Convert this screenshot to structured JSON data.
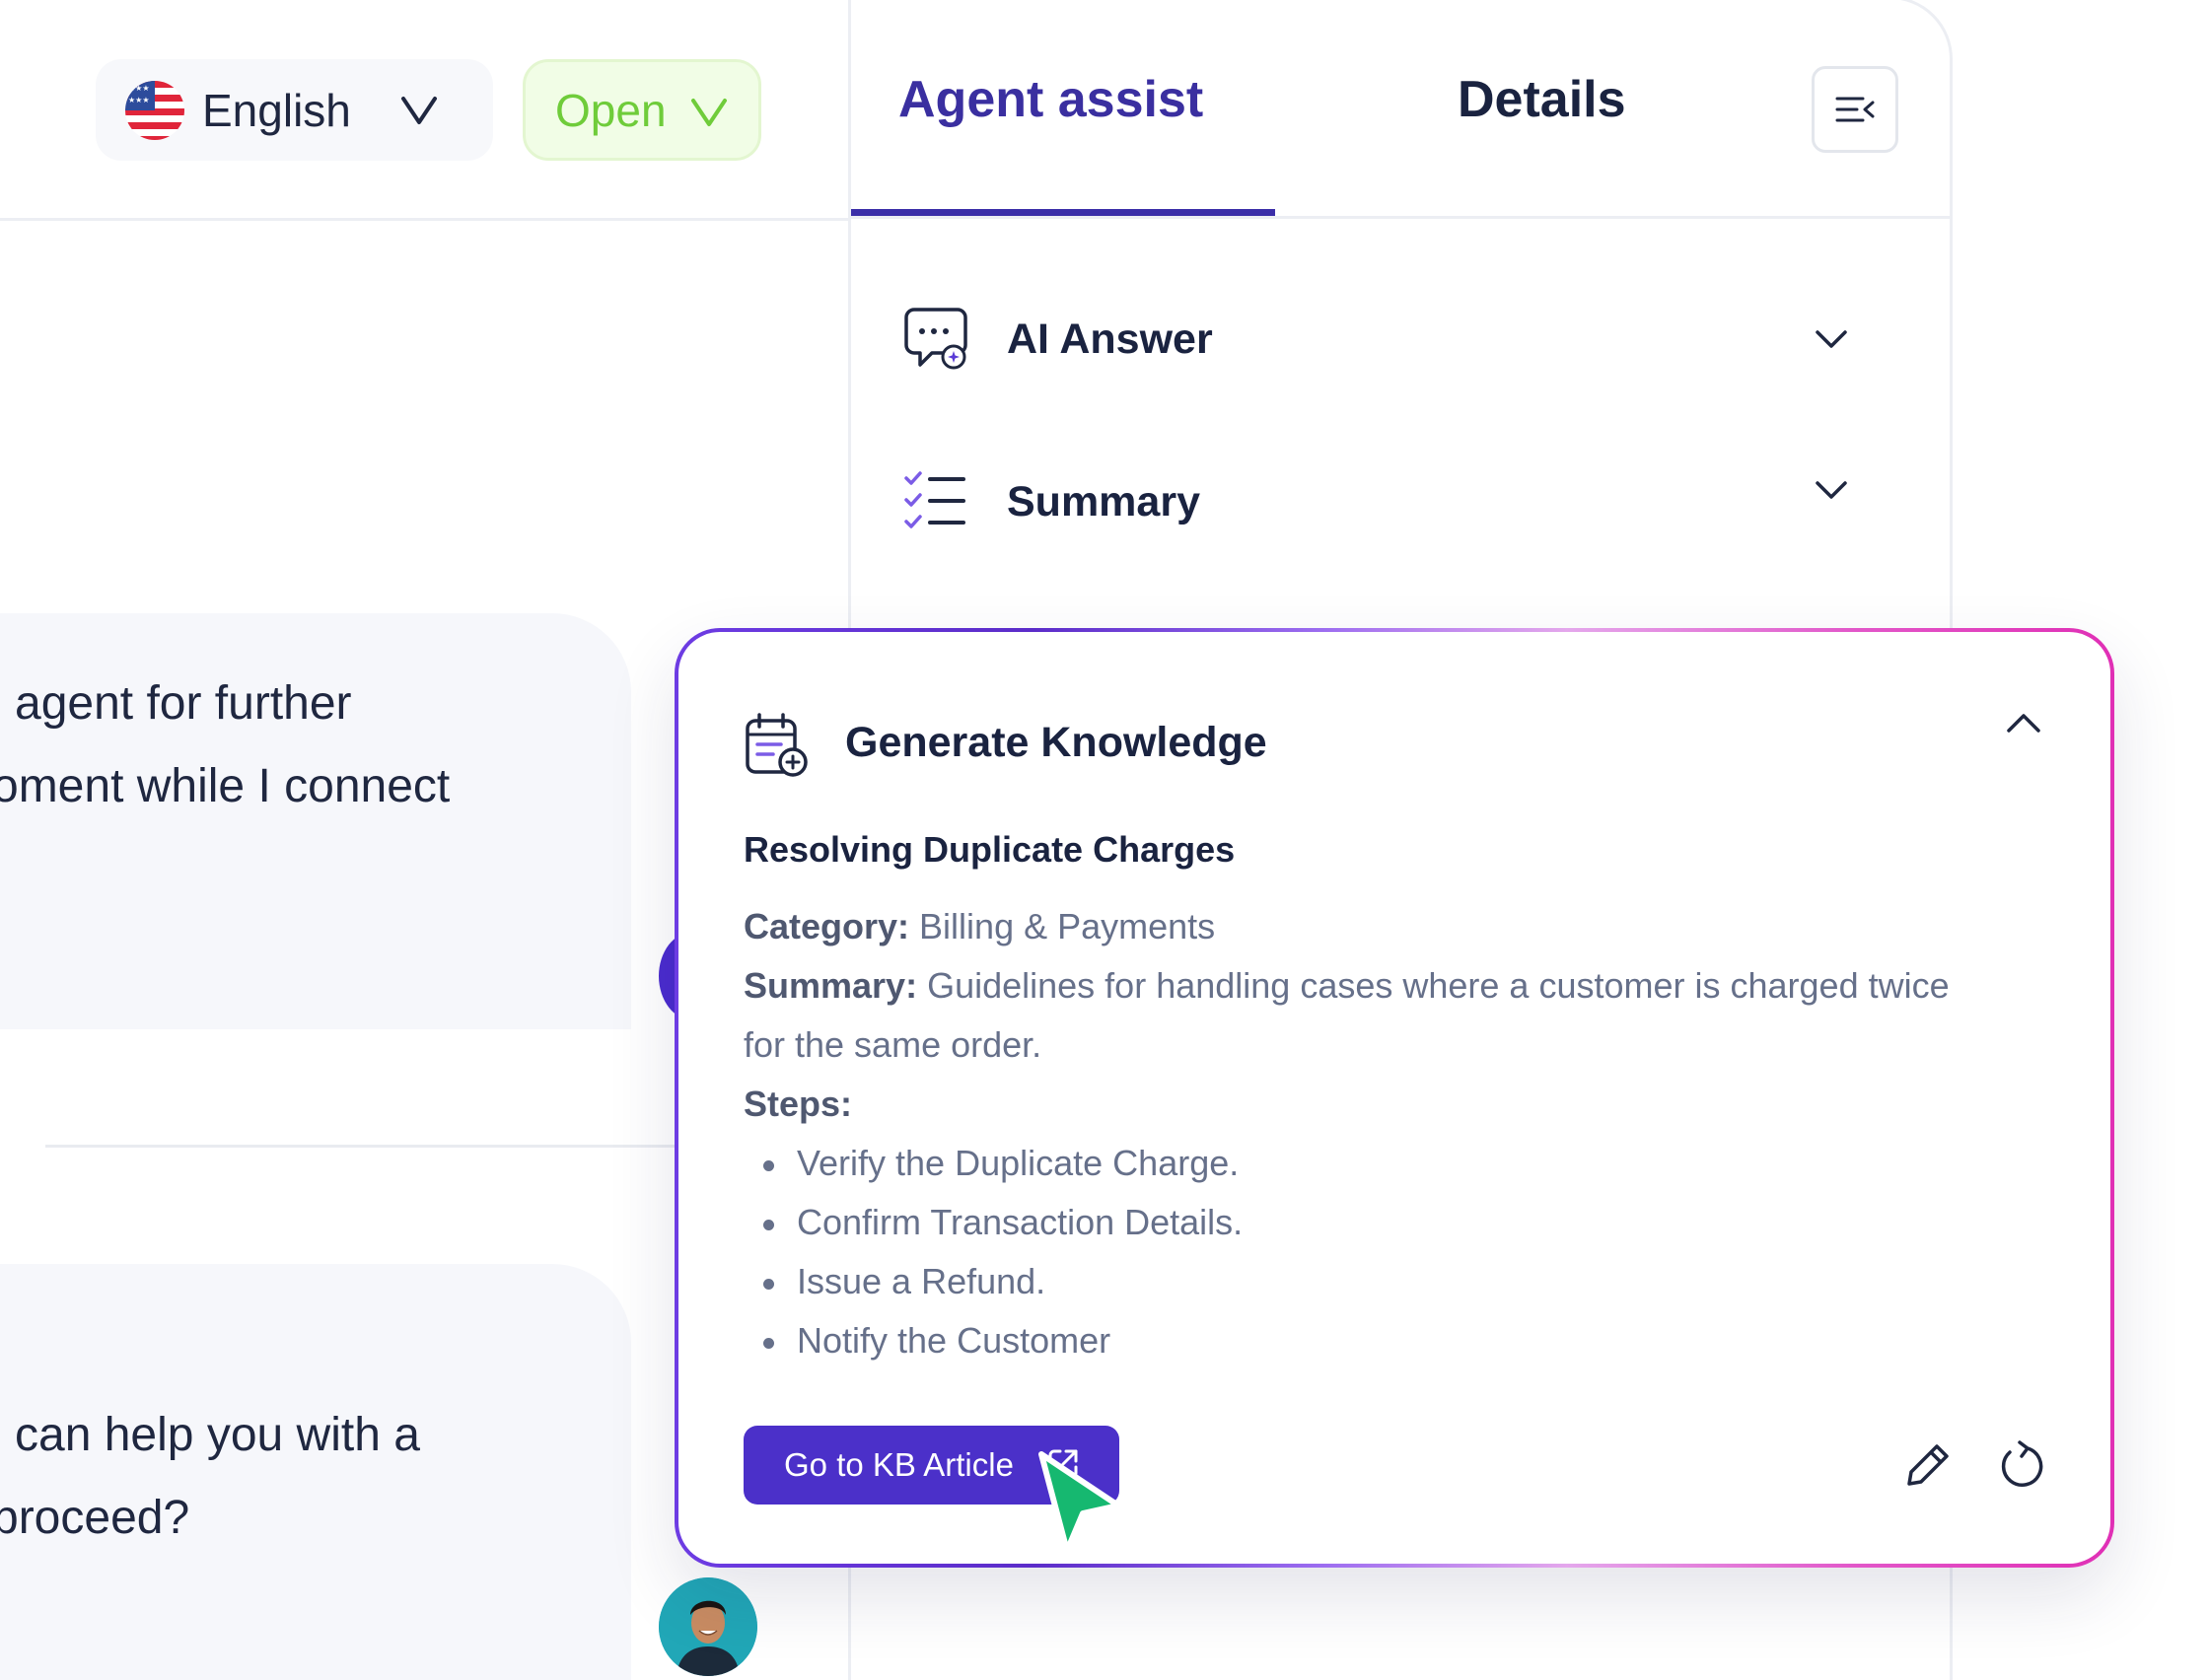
{
  "header": {
    "language": {
      "label": "English",
      "flag": "us-flag-icon"
    },
    "status": {
      "label": "Open",
      "color": "#6fcc3a"
    }
  },
  "chat": {
    "bubble_1": [
      "agent for further",
      "oment while I connect"
    ],
    "bubble_2": [
      "can help you with a",
      "proceed?"
    ]
  },
  "assist": {
    "tabs": [
      {
        "label": "Agent assist",
        "active": true
      },
      {
        "label": "Details",
        "active": false
      }
    ],
    "menu_icon": "collapse-menu-icon",
    "sections": [
      {
        "title": "AI Answer",
        "icon": "ai-chat-icon",
        "expanded": false
      },
      {
        "title": "Summary",
        "icon": "checklist-icon",
        "expanded": false
      }
    ]
  },
  "knowledge": {
    "title": "Generate Knowledge",
    "icon": "knowledge-calendar-icon",
    "expanded": true,
    "article_title": "Resolving Duplicate Charges",
    "category_label": "Category:",
    "category_value": "Billing & Payments",
    "summary_label": "Summary:",
    "summary_value_1": "Guidelines for handling cases where a customer is charged twice",
    "summary_value_2": "for the same order.",
    "steps_label": "Steps:",
    "steps": [
      "Verify the Duplicate Charge.",
      "Confirm Transaction Details.",
      "Issue a Refund.",
      "Notify the Customer"
    ],
    "button_label": "Go to KB Article",
    "button_icon": "external-link-icon",
    "actions": [
      "pencil-icon",
      "refresh-icon"
    ]
  },
  "colors": {
    "accent": "#4b30c9",
    "tab_active": "#3a2fa0",
    "text_dark": "#1a2340",
    "text_muted": "#66708a",
    "cursor": "#16b870",
    "card_border_start": "#6d3ce3",
    "card_border_end": "#e02fb5"
  }
}
